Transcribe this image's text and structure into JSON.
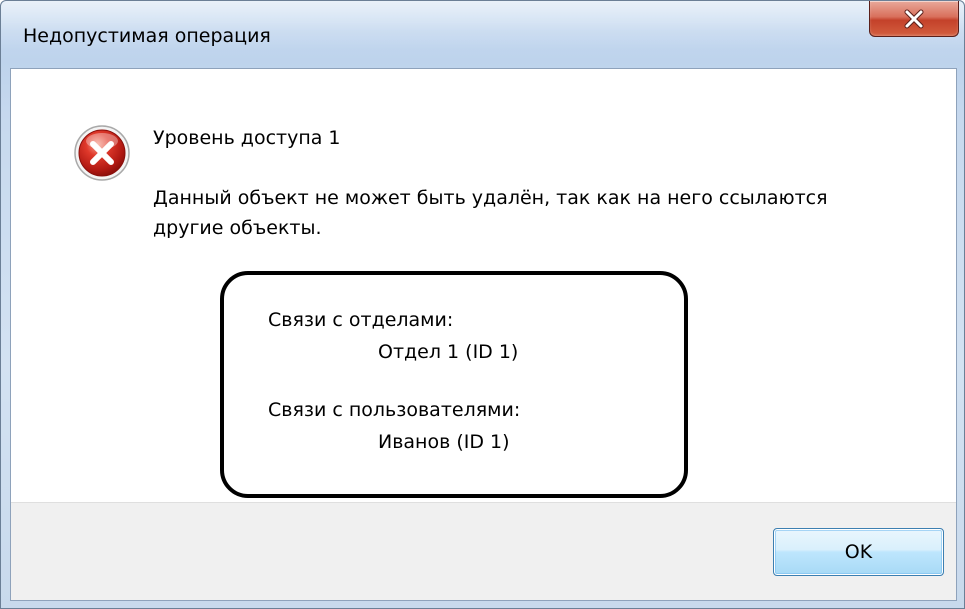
{
  "window": {
    "title": "Недопустимая операция",
    "close_icon": "close-icon"
  },
  "dialog": {
    "icon": "error-icon",
    "heading": "Уровень доступа 1",
    "message_line1": "Данный объект не может быть удалён, так как на него ссылаются",
    "message_line2": "другие объекты."
  },
  "details": {
    "departments_label": "Связи с отделами:",
    "department_item": "Отдел 1 (ID 1)",
    "users_label": "Связи с пользователями:",
    "user_item": "Иванов (ID 1)"
  },
  "buttons": {
    "ok_label": "OK"
  },
  "colors": {
    "close_button": "#c4412a",
    "error_icon": "#c8201c",
    "ok_button_border": "#3c7fb1",
    "footer_background": "#f0f0f0"
  }
}
